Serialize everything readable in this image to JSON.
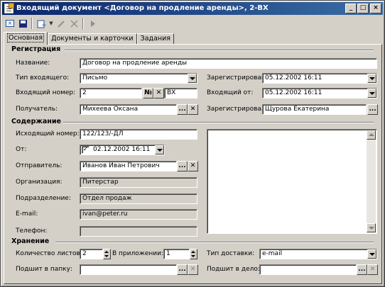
{
  "window": {
    "title": "Входящий документ <Договор на продление аренды>, 2-ВХ",
    "min_glyph": "_",
    "max_glyph": "□",
    "close_glyph": "×"
  },
  "toolbar": {
    "dropdown_glyph": "▼"
  },
  "tabs": [
    "Основная",
    "Документы и карточки",
    "Задания"
  ],
  "registration": {
    "section_title": "Регистрация",
    "name_label": "Название:",
    "name_value": "Договор на продление аренды",
    "type_label": "Тип входящего:",
    "type_value": "Письмо",
    "registered_label": "Зарегистрирован:",
    "registered_value": "05.12.2002 16:11",
    "in_number_label": "Входящий номер:",
    "in_number_value": "2",
    "number_sign": "№",
    "clear_glyph": "✕",
    "suffix_value": "ВХ",
    "in_from_label": "Входящий от:",
    "in_from_value": "05.12.2002 16:11",
    "recipient_label": "Получатель:",
    "recipient_value": "Михеева Оксана",
    "ellipsis": "...",
    "registered_by_label": "Зарегистрировал:",
    "registered_by_value": "Щурова Екатерина"
  },
  "content": {
    "section_title": "Содержание",
    "out_number_label": "Исходящий номер:",
    "out_number_value": "122/123/-ДЛ",
    "from_label": "От:",
    "from_checked": "✓",
    "from_value": "02.12.2002 16:11",
    "sender_label": "Отправитель:",
    "sender_value": "Иванов Иван Петрович",
    "org_label": "Организация:",
    "org_value": "Питерстар",
    "dept_label": "Подразделение:",
    "dept_value": "Отдел продаж",
    "email_label": "E-mail:",
    "email_value": "ivan@peter.ru",
    "phone_label": "Телефон:",
    "phone_value": ""
  },
  "storage": {
    "section_title": "Хранение",
    "sheets_label": "Количество листов:",
    "sheets_value": "2",
    "attach_label": "В приложении:",
    "attach_value": "1",
    "delivery_label": "Тип доставки:",
    "delivery_value": "e-mail",
    "folder_label": "Подшит в папку:",
    "folder_value": "",
    "case_label": "Подшит в дело:",
    "case_value": ""
  }
}
